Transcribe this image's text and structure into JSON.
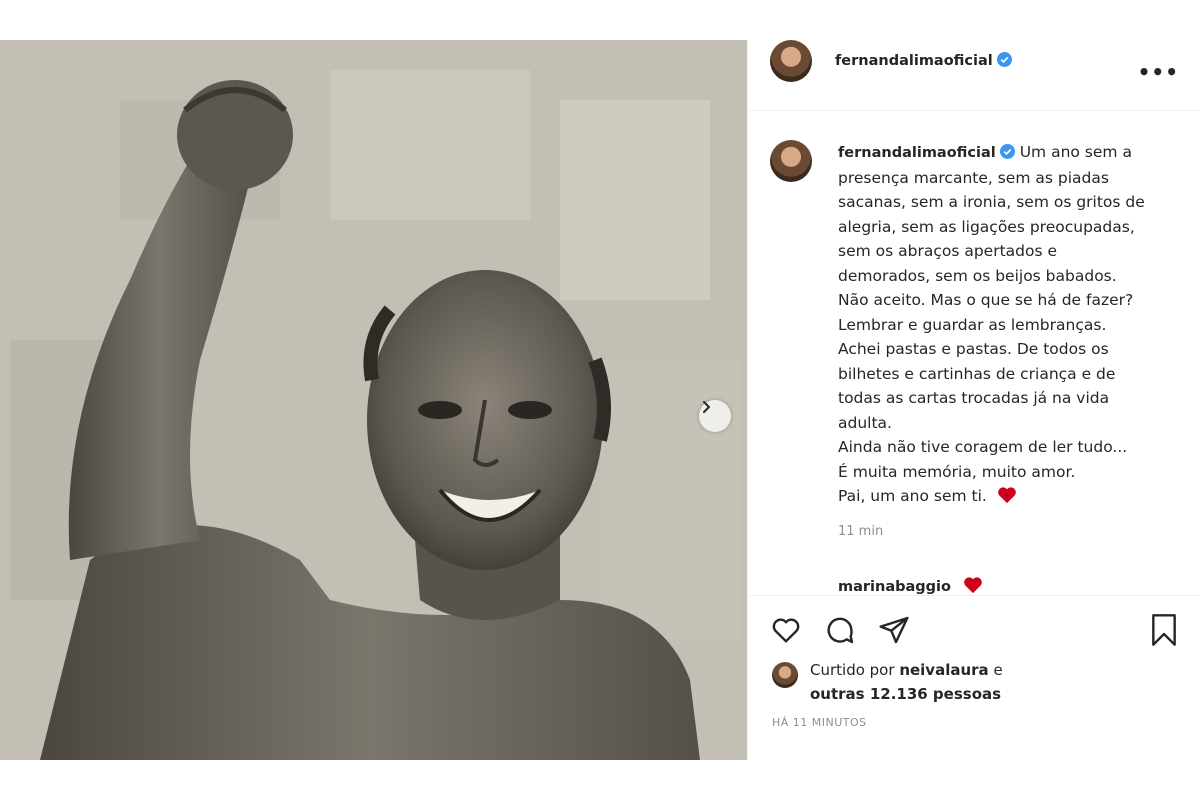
{
  "post": {
    "author": "fernandalimaoficial",
    "caption_lines": [
      "Um ano sem a",
      "presença marcante, sem as piadas",
      "sacanas, sem a ironia, sem os gritos de",
      "alegria, sem as ligações preocupadas,",
      "sem os abraços apertados e",
      "demorados, sem os beijos babados.",
      "Não aceito. Mas o que se há de fazer?",
      "Lembrar e guardar as lembranças.",
      "Achei pastas e pastas. De todos os",
      "bilhetes e cartinhas de criança e de",
      "todas as cartas trocadas já na vida",
      "adulta.",
      "Ainda não tive coragem de ler tudo...",
      "É muita memória, muito amor.",
      "Pai, um ano sem ti."
    ],
    "caption_time": "11 min",
    "next_comment_user": "marinabaggio",
    "likes_prefix": "Curtido por",
    "likes_user": "neivalaura",
    "likes_connector": "e",
    "likes_others": "outras 12.136 pessoas",
    "posted_ago": "HÁ 11 MINUTOS"
  },
  "icons": {
    "verified": "verified-badge-icon",
    "more": "more-options-icon",
    "heart": "heart-icon",
    "comment": "comment-icon",
    "share": "share-icon",
    "save": "bookmark-icon",
    "next": "chevron-right-icon",
    "red_heart": "red-heart-emoji"
  },
  "colors": {
    "verified": "#3897f0",
    "red_heart": "#d0021b",
    "muted": "#8e8e8e"
  },
  "ui": {
    "more_label": "•••"
  }
}
